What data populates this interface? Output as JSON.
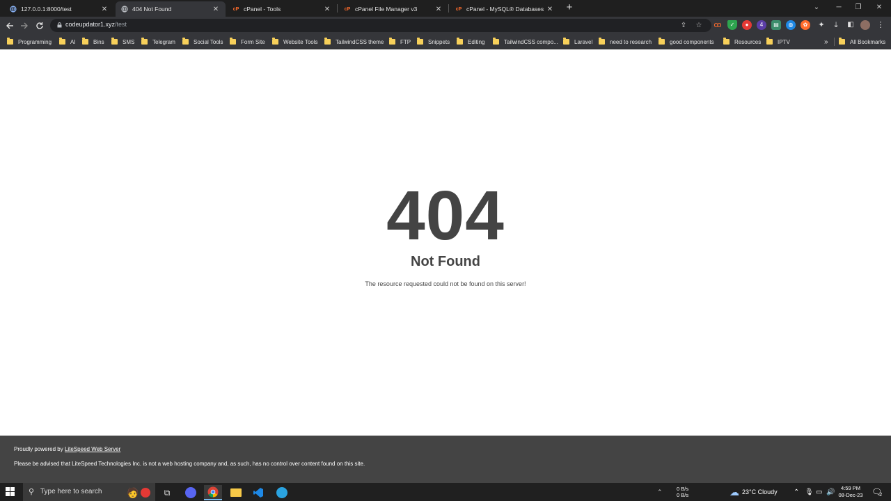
{
  "browser": {
    "tabs": [
      {
        "title": "127.0.0.1:8000/test",
        "icon": "globe-icon",
        "active": false
      },
      {
        "title": "404 Not Found",
        "icon": "globe-icon",
        "active": true
      },
      {
        "title": "cPanel - Tools",
        "icon": "cpanel-icon",
        "active": false
      },
      {
        "title": "cPanel File Manager v3",
        "icon": "cpanel-icon",
        "active": false
      },
      {
        "title": "cPanel - MySQL® Databases",
        "icon": "cpanel-icon",
        "active": false
      }
    ],
    "new_tab_label": "+",
    "url_host": "codeupdator1.xyz",
    "url_path": "/test",
    "bookmarks": [
      "Programming",
      "AI",
      "Bins",
      "SMS",
      "Telegram",
      "Social Tools",
      "Form Site",
      "Website Tools",
      "TailwindCSS theme",
      "FTP",
      "Snippets",
      "Editing",
      "TailwindCSS compo...",
      "Laravel",
      "need to research",
      "good components",
      "Resources",
      "IPTV"
    ],
    "overflow_label": "»",
    "all_bookmarks_label": "All Bookmarks",
    "accent_colors": {
      "tabbar": "#1f1f1f",
      "toolbar": "#35363a",
      "folder": "#f7d05a"
    }
  },
  "page": {
    "code": "404",
    "title": "Not Found",
    "message": "The resource requested could not be found on this server!",
    "footer": {
      "powered_prefix": "Proudly powered by ",
      "powered_link": "LiteSpeed Web Server",
      "notice": "Please be advised that LiteSpeed Technologies Inc. is not a web hosting company and, as such, has no control over content found on this site."
    }
  },
  "taskbar": {
    "search_placeholder": "Type here to search",
    "net_up": "0 B/s",
    "net_down": "0 B/s",
    "weather": "23°C  Cloudy",
    "time": "4:59 PM",
    "date": "08-Dec-23",
    "notification_count": "2"
  }
}
